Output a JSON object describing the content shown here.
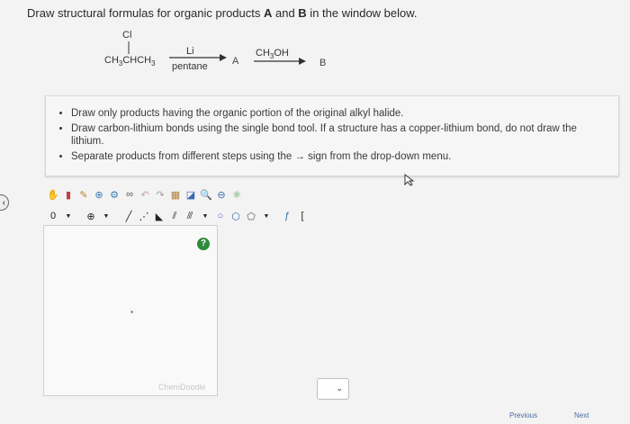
{
  "question": {
    "text_before": "Draw structural formulas for organic products ",
    "label_a": "A",
    "text_and": " and ",
    "label_b": "B",
    "text_after": " in the window below."
  },
  "scheme": {
    "substituent": "Cl",
    "reactant": "CH3CHCH3",
    "reagent1_top": "Li",
    "reagent1_bottom": "pentane",
    "product_a": "A",
    "reagent2_top": "CH3OH",
    "product_b": "B"
  },
  "instructions": [
    "Draw only products having the organic portion of the original alkyl halide.",
    "Draw carbon-lithium bonds using the single bond tool. If a structure has a copper-lithium bond, do not draw the lithium.",
    "Separate products from different steps using the → sign from the drop-down menu."
  ],
  "toolbar": {
    "row1_icons": [
      "hand-icon",
      "eraser-icon",
      "pencil-icon",
      "zoom-plus-icon",
      "ring-icon",
      "lasso-icon",
      "undo-icon",
      "redo-icon",
      "template-icon",
      "clean-icon",
      "zoom-in-icon",
      "zoom-out-icon",
      "atom-map-icon"
    ],
    "row2_icons": [
      "charge-icon",
      "add-atom-icon",
      "single-bond-icon",
      "dashed-bond-icon",
      "wedge-bond-icon",
      "double-bond-icon",
      "cyclopropane-icon",
      "benzene-icon",
      "hexagon-icon",
      "pentagon-icon",
      "function-icon",
      "bracket-icon"
    ],
    "charge_label": "0",
    "help_label": "?"
  },
  "canvas": {
    "watermark": "ChemDoodle"
  },
  "nav": {
    "previous": "Previous",
    "next": "Next"
  }
}
